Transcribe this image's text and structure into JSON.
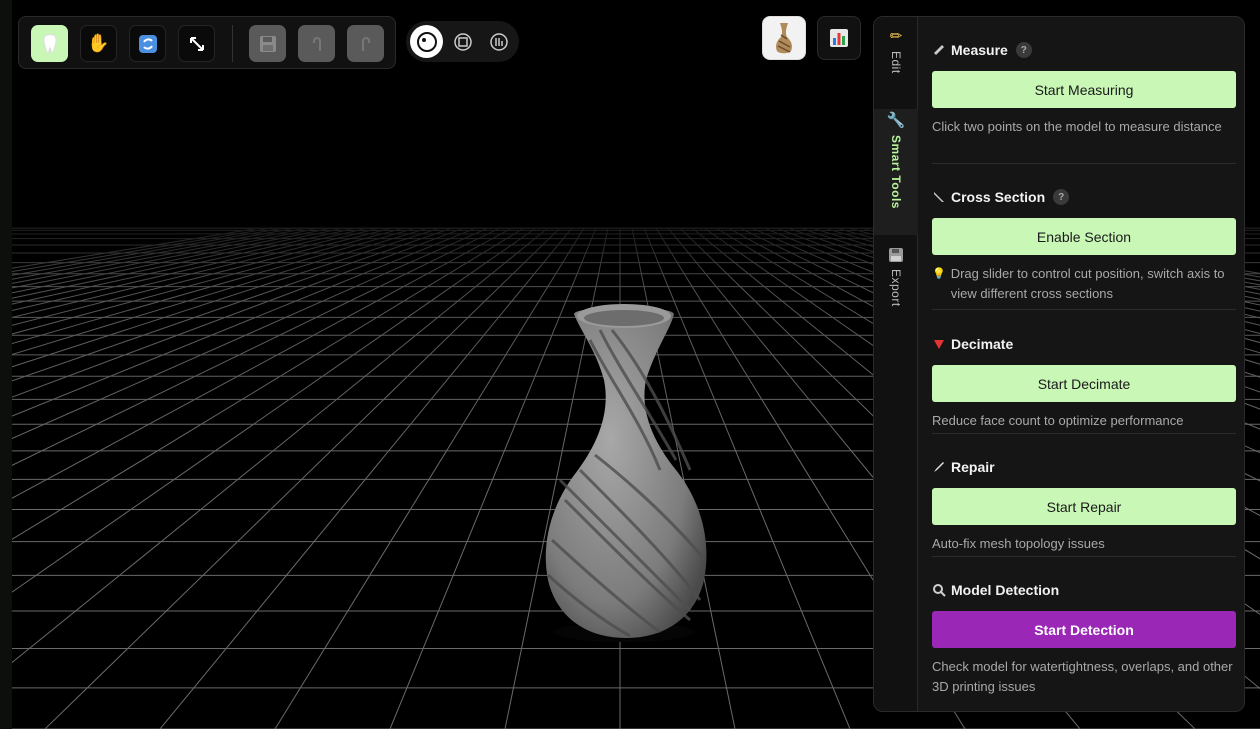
{
  "toolbar": {
    "buttons": [
      {
        "icon": "tooth-icon",
        "state": "active"
      },
      {
        "icon": "hand-pan-icon",
        "state": "normal"
      },
      {
        "icon": "rotate-icon",
        "state": "normal"
      },
      {
        "icon": "scale-arrows-icon",
        "state": "normal"
      },
      {
        "icon": "save-icon",
        "state": "disabled"
      },
      {
        "icon": "undo-icon",
        "state": "disabled"
      },
      {
        "icon": "redo-icon",
        "state": "disabled"
      }
    ],
    "view_modes": [
      {
        "icon": "solid-view-icon",
        "state": "active"
      },
      {
        "icon": "wireframe-view-icon",
        "state": "normal"
      },
      {
        "icon": "xray-view-icon",
        "state": "normal"
      }
    ]
  },
  "thumbnails": [
    "vase-model-thumbnail",
    "chart-icon"
  ],
  "panel": {
    "tabs": [
      {
        "label": "Edit",
        "icon": "pencil-icon",
        "active": false
      },
      {
        "label": "Smart Tools",
        "icon": "wrench-icon",
        "active": true
      },
      {
        "label": "Export",
        "icon": "floppy-icon",
        "active": false
      }
    ],
    "sections": {
      "measure": {
        "title": "Measure",
        "help": "?",
        "button": "Start Measuring",
        "desc": "Click two points on the model to measure distance"
      },
      "cross_section": {
        "title": "Cross Section",
        "help": "?",
        "button": "Enable Section",
        "desc": "Drag slider to control cut position, switch axis to view different cross sections"
      },
      "decimate": {
        "title": "Decimate",
        "button": "Start Decimate",
        "desc": "Reduce face count to optimize performance"
      },
      "repair": {
        "title": "Repair",
        "button": "Start Repair",
        "desc": "Auto-fix mesh topology issues"
      },
      "detection": {
        "title": "Model Detection",
        "button": "Start Detection",
        "desc": "Check model for watertightness, overlaps, and other 3D printing issues"
      }
    }
  },
  "colors": {
    "accent_green": "#c9f7b6",
    "accent_purple": "#9b27b6",
    "panel_bg": "#151515"
  }
}
